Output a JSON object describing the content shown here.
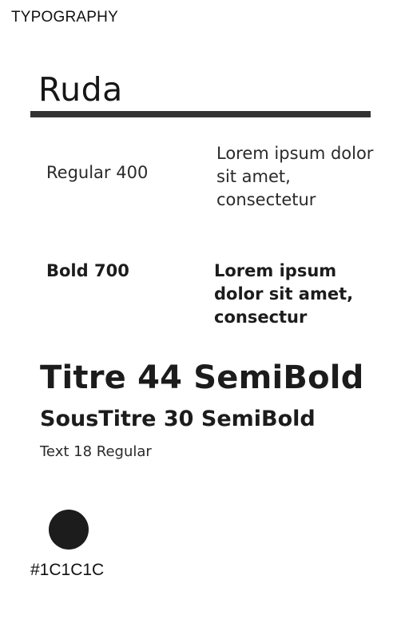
{
  "section": {
    "label": "TYPOGRAPHY"
  },
  "font": {
    "name": "Ruda"
  },
  "weights": [
    {
      "label": "Regular 400",
      "sample": "Lorem ipsum dolor sit amet, consectetur"
    },
    {
      "label": "Bold 700",
      "sample": "Lorem ipsum dolor sit amet, consectur"
    }
  ],
  "specs": {
    "title": "Titre 44 SemiBold",
    "subtitle": "SousTitre 30 SemiBold",
    "text": "Text 18 Regular"
  },
  "color": {
    "hex": "#1C1C1C",
    "value": "#1c1c1c"
  }
}
